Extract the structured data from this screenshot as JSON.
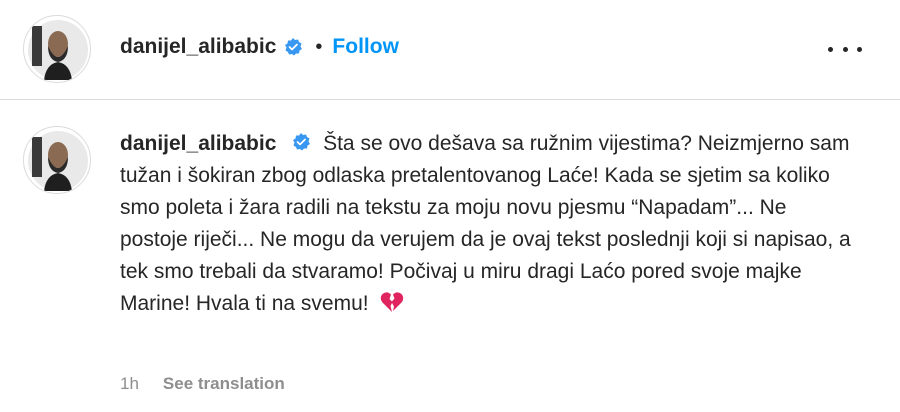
{
  "header": {
    "username": "danijel_alibabic",
    "separator": "•",
    "follow_label": "Follow"
  },
  "comment": {
    "username": "danijel_alibabic",
    "text": "Šta se ovo dešava sa ružnim vijestima? Neizmjerno sam tužan i šokiran zbog odlaska pretalentovanog Laće! Kada se sjetim sa koliko smo poleta i žara radili na tekstu za moju novu pjesmu “Napadam”... Ne postoje riječi... Ne mogu da verujem da je ovaj tekst poslednji koji si napisao, a tek smo trebali da stvaramo! Počivaj u miru dragi Laćo pored svoje majke Marine! Hvala ti na svemu!",
    "emoji": "broken-heart-icon",
    "time": "1h",
    "see_translation": "See translation"
  },
  "colors": {
    "accent": "#0095f6",
    "text": "#262626",
    "muted": "#8e8e8e",
    "verified": "#3897f0",
    "heart": "#e0245e"
  }
}
